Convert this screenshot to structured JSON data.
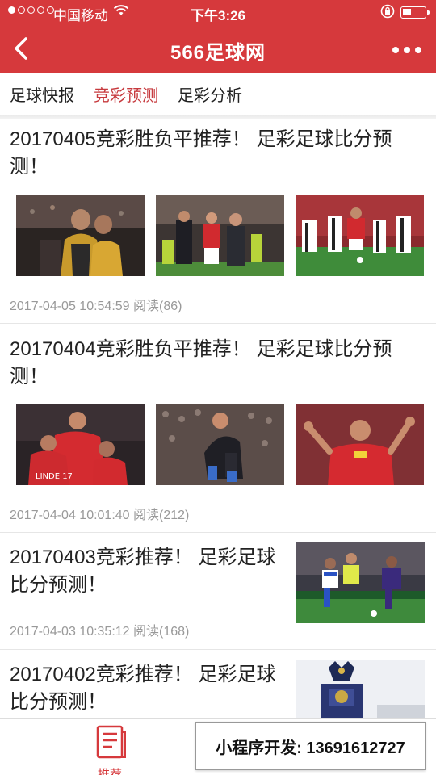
{
  "status_bar": {
    "carrier": "中国移动",
    "time": "下午3:26"
  },
  "nav": {
    "title": "566足球网"
  },
  "tabs": [
    {
      "label": "足球快报",
      "active": false
    },
    {
      "label": "竞彩预测",
      "active": true
    },
    {
      "label": "足彩分析",
      "active": false
    }
  ],
  "articles": [
    {
      "title": "20170405竞彩胜负平推荐！ 足彩足球比分预测！",
      "meta": "2017-04-05 10:54:59 阅读(86)"
    },
    {
      "title": "20170404竞彩胜负平推荐！ 足彩足球比分预测！",
      "meta": "2017-04-04 10:01:40 阅读(212)"
    },
    {
      "title": "20170403竞彩推荐！ 足彩足球比分预测！",
      "meta": "2017-04-03 10:35:12 阅读(168)"
    },
    {
      "title": "20170402竞彩推荐！ 足彩足球比分预测！",
      "meta": ""
    }
  ],
  "bottom_bar": {
    "recommend_label": "推荐"
  },
  "promo": {
    "text": "小程序开发: 13691612727"
  },
  "colors": {
    "brand_red": "#d6393c",
    "active_tab": "#c73a3e"
  }
}
